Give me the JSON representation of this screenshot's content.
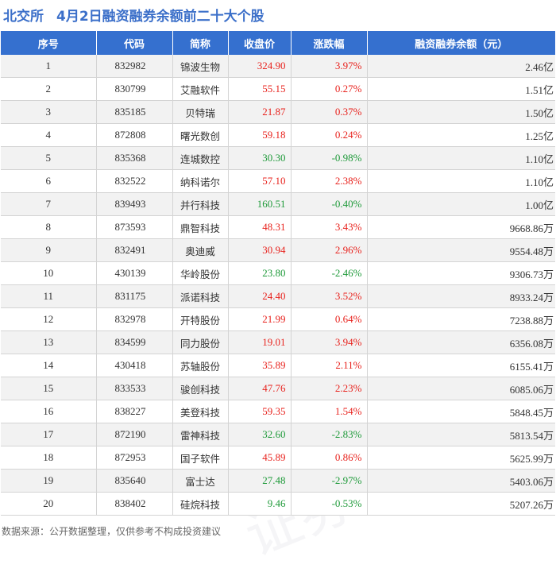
{
  "header": {
    "exchange": "北交所",
    "title": "4月2日融资融券余额前二十大个股"
  },
  "table": {
    "columns": [
      "序号",
      "代码",
      "简称",
      "收盘价",
      "涨跌幅",
      "融资融券余额（元）"
    ],
    "rows": [
      {
        "rank": "1",
        "code": "832982",
        "name": "锦波生物",
        "price": "324.90",
        "change": "3.97%",
        "direction": "up",
        "balance": "2.46亿"
      },
      {
        "rank": "2",
        "code": "830799",
        "name": "艾融软件",
        "price": "55.15",
        "change": "0.27%",
        "direction": "up",
        "balance": "1.51亿"
      },
      {
        "rank": "3",
        "code": "835185",
        "name": "贝特瑞",
        "price": "21.87",
        "change": "0.37%",
        "direction": "up",
        "balance": "1.50亿"
      },
      {
        "rank": "4",
        "code": "872808",
        "name": "曙光数创",
        "price": "59.18",
        "change": "0.24%",
        "direction": "up",
        "balance": "1.25亿"
      },
      {
        "rank": "5",
        "code": "835368",
        "name": "连城数控",
        "price": "30.30",
        "change": "-0.98%",
        "direction": "down",
        "balance": "1.10亿"
      },
      {
        "rank": "6",
        "code": "832522",
        "name": "纳科诺尔",
        "price": "57.10",
        "change": "2.38%",
        "direction": "up",
        "balance": "1.10亿"
      },
      {
        "rank": "7",
        "code": "839493",
        "name": "并行科技",
        "price": "160.51",
        "change": "-0.40%",
        "direction": "down",
        "balance": "1.00亿"
      },
      {
        "rank": "8",
        "code": "873593",
        "name": "鼎智科技",
        "price": "48.31",
        "change": "3.43%",
        "direction": "up",
        "balance": "9668.86万"
      },
      {
        "rank": "9",
        "code": "832491",
        "name": "奥迪威",
        "price": "30.94",
        "change": "2.96%",
        "direction": "up",
        "balance": "9554.48万"
      },
      {
        "rank": "10",
        "code": "430139",
        "name": "华岭股份",
        "price": "23.80",
        "change": "-2.46%",
        "direction": "down",
        "balance": "9306.73万"
      },
      {
        "rank": "11",
        "code": "831175",
        "name": "派诺科技",
        "price": "24.40",
        "change": "3.52%",
        "direction": "up",
        "balance": "8933.24万"
      },
      {
        "rank": "12",
        "code": "832978",
        "name": "开特股份",
        "price": "21.99",
        "change": "0.64%",
        "direction": "up",
        "balance": "7238.88万"
      },
      {
        "rank": "13",
        "code": "834599",
        "name": "同力股份",
        "price": "19.01",
        "change": "3.94%",
        "direction": "up",
        "balance": "6356.08万"
      },
      {
        "rank": "14",
        "code": "430418",
        "name": "苏轴股份",
        "price": "35.89",
        "change": "2.11%",
        "direction": "up",
        "balance": "6155.41万"
      },
      {
        "rank": "15",
        "code": "833533",
        "name": "骏创科技",
        "price": "47.76",
        "change": "2.23%",
        "direction": "up",
        "balance": "6085.06万"
      },
      {
        "rank": "16",
        "code": "838227",
        "name": "美登科技",
        "price": "59.35",
        "change": "1.54%",
        "direction": "up",
        "balance": "5848.45万"
      },
      {
        "rank": "17",
        "code": "872190",
        "name": "雷神科技",
        "price": "32.60",
        "change": "-2.83%",
        "direction": "down",
        "balance": "5813.54万"
      },
      {
        "rank": "18",
        "code": "872953",
        "name": "国子软件",
        "price": "45.89",
        "change": "0.86%",
        "direction": "up",
        "balance": "5625.99万"
      },
      {
        "rank": "19",
        "code": "835640",
        "name": "富士达",
        "price": "27.48",
        "change": "-2.97%",
        "direction": "down",
        "balance": "5403.06万"
      },
      {
        "rank": "20",
        "code": "838402",
        "name": "硅烷科技",
        "price": "9.46",
        "change": "-0.53%",
        "direction": "down",
        "balance": "5207.26万"
      }
    ]
  },
  "footer": {
    "source": "数据来源：公开数据整理，仅供参考不构成投资建议"
  },
  "colors": {
    "header_bg": "#3570cf",
    "title": "#3b6fc9",
    "up": "#e8231e",
    "down": "#1f9a3a",
    "stripe": "#f2f2f2"
  },
  "watermark": "证券之星"
}
